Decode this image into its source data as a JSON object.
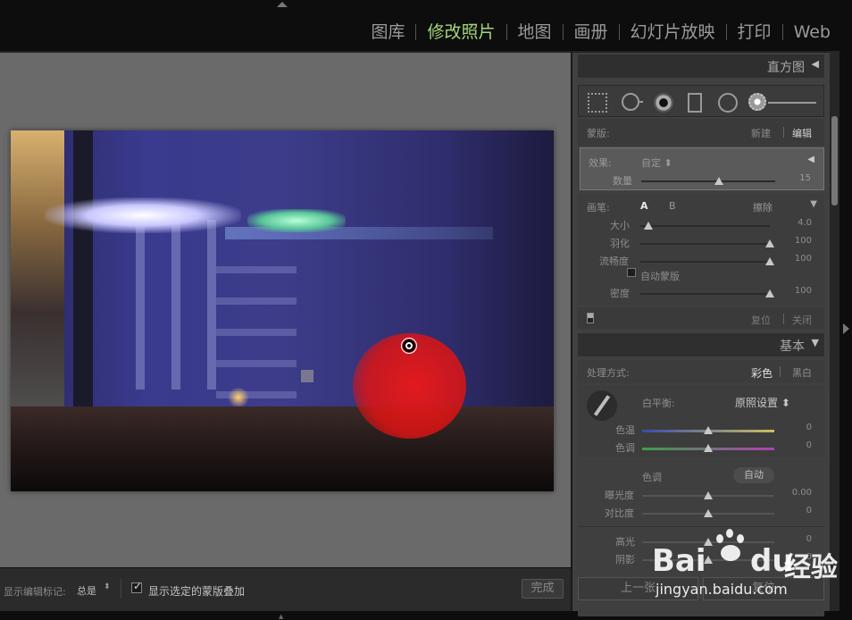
{
  "modules": {
    "library": "图库",
    "develop": "修改照片",
    "map": "地图",
    "book": "画册",
    "slideshow": "幻灯片放映",
    "print": "打印",
    "web": "Web"
  },
  "panel": {
    "histogram_title": "直方图",
    "mask": {
      "label": "蒙版:",
      "new": "新建",
      "edit": "编辑"
    },
    "effect": {
      "label": "效果:",
      "value": "自定 ⬍",
      "amount_label": "数量",
      "amount_value": "15",
      "amount_fraction": 0.58
    },
    "brush": {
      "label": "画笔:",
      "a": "A",
      "b": "B",
      "erase": "擦除",
      "size_label": "大小",
      "size_value": "4.0",
      "size_fraction": 0.06,
      "feather_label": "羽化",
      "feather_value": "100",
      "feather_fraction": 1.0,
      "flow_label": "流畅度",
      "flow_value": "100",
      "flow_fraction": 1.0,
      "automask_label": "自动蒙版",
      "density_label": "密度",
      "density_value": "100",
      "density_fraction": 1.0
    },
    "mask_footer": {
      "reset": "复位",
      "close": "关闭"
    },
    "basic": {
      "title": "基本",
      "treatment_label": "处理方式:",
      "color": "彩色",
      "bw": "黑白",
      "wb_label": "白平衡:",
      "wb_value": "原照设置 ⬍",
      "temp_label": "色温",
      "temp_value": "0",
      "tint_label": "色调",
      "tint_value": "0",
      "tone_label": "色调",
      "auto": "自动",
      "exposure_label": "曝光度",
      "exposure_value": "0.00",
      "contrast_label": "对比度",
      "contrast_value": "0",
      "highlights_label": "高光",
      "highlights_value": "0",
      "shadows_label": "阴影",
      "shadows_value": "0"
    },
    "prev_button": "上一张",
    "reset_button": "复位"
  },
  "toolbar": {
    "show_edit_pins_label": "显示编辑标记:",
    "show_edit_pins_value": "总是",
    "overlay_label": "显示选定的蒙版叠加",
    "done": "完成"
  },
  "watermark": {
    "bai": "Bai",
    "du": "du",
    "jingyan": "经验",
    "url": "jingyan.baidu.com"
  },
  "colors": {
    "active_module": "#a6d67a",
    "mask_overlay": "#e01919"
  }
}
